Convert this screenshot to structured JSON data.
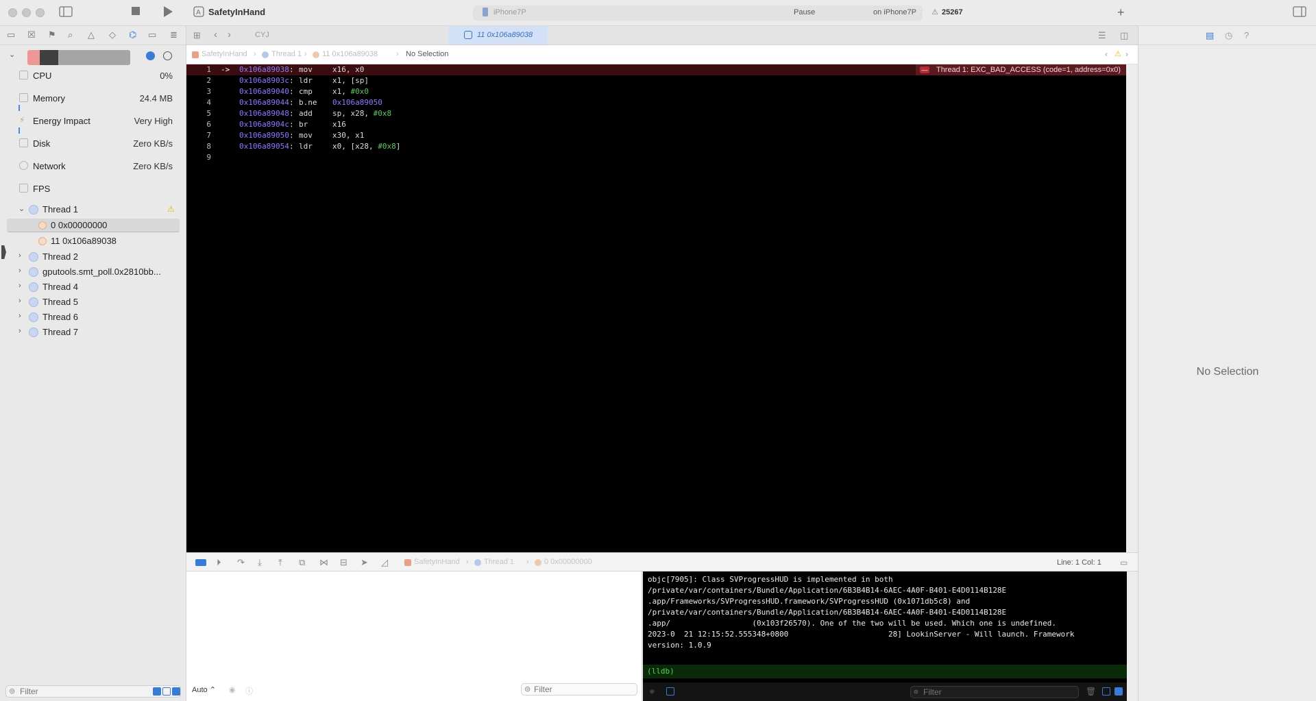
{
  "window": {
    "app_title": "SafetyInHand",
    "device": "iPhone7P",
    "status": "Pause",
    "run_destination": "on iPhone7P",
    "issue_count": "25267"
  },
  "tabbar": {
    "first_tab": "CYJ",
    "active_tab": "11 0x106a89038"
  },
  "jumpbar": {
    "project": "SafetyInHand",
    "thread": "Thread 1",
    "frame": "11 0x106a89038",
    "selection": "No Selection"
  },
  "navigator": {
    "gauges": [
      {
        "label": "CPU",
        "value": "0%"
      },
      {
        "label": "Memory",
        "value": "24.4 MB"
      },
      {
        "label": "Energy Impact",
        "value": "Very High"
      },
      {
        "label": "Disk",
        "value": "Zero KB/s"
      },
      {
        "label": "Network",
        "value": "Zero KB/s"
      },
      {
        "label": "FPS",
        "value": ""
      }
    ],
    "threads": [
      {
        "label": "Thread 1",
        "expanded": true
      },
      {
        "label": "Thread 2",
        "expanded": false
      },
      {
        "label": "gputools.smt_poll.0x2810bb...",
        "expanded": false
      },
      {
        "label": "Thread 4",
        "expanded": false
      },
      {
        "label": "Thread 5",
        "expanded": false
      },
      {
        "label": "Thread 6",
        "expanded": false
      },
      {
        "label": "Thread 7",
        "expanded": false
      }
    ],
    "frames": [
      {
        "label": "0 0x00000000",
        "selected": true
      },
      {
        "label": "11 0x106a89038",
        "selected": false
      }
    ],
    "filter_placeholder": "Filter"
  },
  "editor": {
    "lines": [
      {
        "num": "1",
        "arrow": "->",
        "addr": "0x106a89038",
        "op": "mov",
        "args": [
          {
            "t": "x16, x0",
            "k": "plain"
          }
        ]
      },
      {
        "num": "2",
        "arrow": "",
        "addr": "0x106a8903c",
        "op": "ldr",
        "args": [
          {
            "t": "x1, [sp]",
            "k": "plain"
          }
        ]
      },
      {
        "num": "3",
        "arrow": "",
        "addr": "0x106a89040",
        "op": "cmp",
        "args": [
          {
            "t": "x1, ",
            "k": "plain"
          },
          {
            "t": "#0x0",
            "k": "lit"
          }
        ]
      },
      {
        "num": "4",
        "arrow": "",
        "addr": "0x106a89044",
        "op": "b.ne",
        "args": [
          {
            "t": "0x106a89050",
            "k": "addr"
          }
        ]
      },
      {
        "num": "5",
        "arrow": "",
        "addr": "0x106a89048",
        "op": "add",
        "args": [
          {
            "t": "sp, x28, ",
            "k": "plain"
          },
          {
            "t": "#0x8",
            "k": "lit"
          }
        ]
      },
      {
        "num": "6",
        "arrow": "",
        "addr": "0x106a8904c",
        "op": "br",
        "args": [
          {
            "t": "x16",
            "k": "plain"
          }
        ]
      },
      {
        "num": "7",
        "arrow": "",
        "addr": "0x106a89050",
        "op": "mov",
        "args": [
          {
            "t": "x30, x1",
            "k": "plain"
          }
        ]
      },
      {
        "num": "8",
        "arrow": "",
        "addr": "0x106a89054",
        "op": "ldr",
        "args": [
          {
            "t": "x0, [x28, ",
            "k": "plain"
          },
          {
            "t": "#0x8",
            "k": "lit"
          },
          {
            "t": "]",
            "k": "plain"
          }
        ]
      },
      {
        "num": "9",
        "arrow": "",
        "addr": "",
        "op": "",
        "args": []
      }
    ],
    "crash_message": "Thread 1: EXC_BAD_ACCESS (code=1, address=0x0)"
  },
  "debugbar": {
    "project": "SafetyInHand",
    "thread": "Thread 1",
    "frame": "0 0x00000000",
    "cursor": "Line: 1  Col: 1"
  },
  "variables": {
    "scope": "Auto",
    "filter_placeholder": "Filter"
  },
  "console": {
    "output": "objc[7905]: Class SVProgressHUD is implemented in both\n/private/var/containers/Bundle/Application/6B3B4B14-6AEC-4A0F-B401-E4D0114B128E\n.app/Frameworks/SVProgressHUD.framework/SVProgressHUD (0x1071db5c8) and\n/private/var/containers/Bundle/Application/6B3B4B14-6AEC-4A0F-B401-E4D0114B128E\n.app/                  (0x103f26570). One of the two will be used. Which one is undefined.\n2023-0  21 12:15:52.555348+0800                      28] LookinServer - Will launch. Framework\nversion: 1.0.9",
    "prompt": "(lldb)",
    "filter_placeholder": "Filter"
  },
  "inspector": {
    "empty_label": "No Selection"
  }
}
